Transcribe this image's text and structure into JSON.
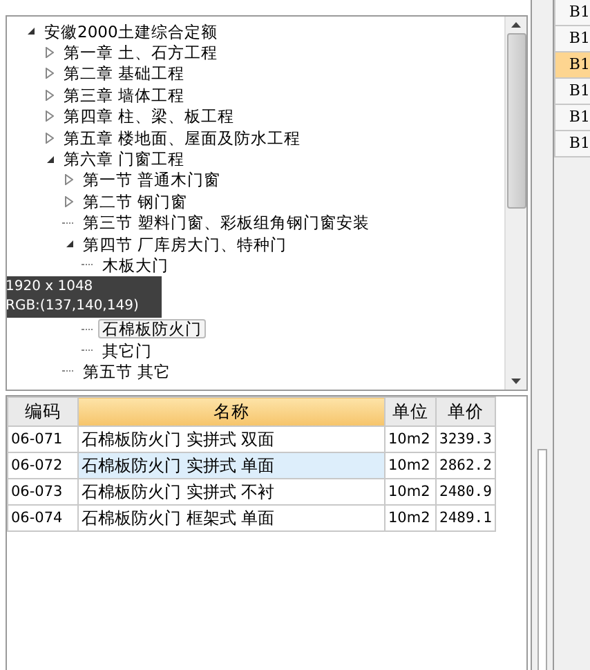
{
  "tree": {
    "label": "安徽2000土建综合定额",
    "kind": "branch",
    "expanded": true,
    "selected": false,
    "children": [
      {
        "label": "第一章 土、石方工程",
        "kind": "branch",
        "expanded": false,
        "selected": false
      },
      {
        "label": "第二章 基础工程",
        "kind": "branch",
        "expanded": false,
        "selected": false
      },
      {
        "label": "第三章 墙体工程",
        "kind": "branch",
        "expanded": false,
        "selected": false
      },
      {
        "label": "第四章 柱、梁、板工程",
        "kind": "branch",
        "expanded": false,
        "selected": false
      },
      {
        "label": "第五章 楼地面、屋面及防水工程",
        "kind": "branch",
        "expanded": false,
        "selected": false
      },
      {
        "label": "第六章 门窗工程",
        "kind": "branch",
        "expanded": true,
        "selected": false,
        "children": [
          {
            "label": "第一节 普通木门窗",
            "kind": "branch",
            "expanded": false,
            "selected": false
          },
          {
            "label": "第二节 钢门窗",
            "kind": "branch",
            "expanded": false,
            "selected": false
          },
          {
            "label": "第三节 塑料门窗、彩板组角钢门窗安装",
            "kind": "leaf",
            "selected": false
          },
          {
            "label": "第四节 厂库房大门、特种门",
            "kind": "branch",
            "expanded": true,
            "selected": false,
            "children": [
              {
                "label": "木板大门",
                "kind": "leaf",
                "selected": false
              },
              {
                "kind": "overlay",
                "lines": [
                  "1920 x 1048",
                  "RGB:(137,140,149)"
                ]
              },
              {
                "label": "石棉板防火门",
                "kind": "leaf",
                "selected": true
              },
              {
                "label": "其它门",
                "kind": "leaf",
                "selected": false
              }
            ]
          },
          {
            "label": "第五节 其它",
            "kind": "leaf",
            "selected": false
          }
        ]
      }
    ]
  },
  "table": {
    "columns": [
      {
        "label": "编码",
        "selected": false
      },
      {
        "label": "名称",
        "selected": true
      },
      {
        "label": "单位",
        "selected": false
      },
      {
        "label": "单价",
        "selected": false
      }
    ],
    "rows": [
      {
        "cells": [
          "06-071",
          "石棉板防火门 实拼式 双面",
          "10m2",
          "3239.3"
        ],
        "selected": false
      },
      {
        "cells": [
          "06-072",
          "石棉板防火门 实拼式 单面",
          "10m2",
          "2862.2"
        ],
        "selected": true
      },
      {
        "cells": [
          "06-073",
          "石棉板防火门 实拼式 不衬",
          "10m2",
          "2480.9"
        ],
        "selected": false
      },
      {
        "cells": [
          "06-074",
          "石棉板防火门 框架式 单面",
          "10m2",
          "2489.1"
        ],
        "selected": false
      }
    ]
  },
  "side_cells": [
    {
      "text": "B1",
      "selected": false
    },
    {
      "text": "B1",
      "selected": false
    },
    {
      "text": "B1",
      "selected": true
    },
    {
      "text": "B1",
      "selected": false
    },
    {
      "text": "B1",
      "selected": false
    },
    {
      "text": "B1",
      "selected": false
    }
  ]
}
